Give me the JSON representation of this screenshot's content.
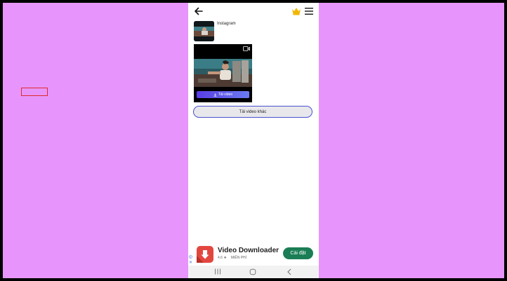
{
  "result": {
    "source_title": "Instagram"
  },
  "video": {
    "download_label": "Tải video"
  },
  "actions": {
    "more_label": "Tải video khác"
  },
  "ad": {
    "title": "Video Downloader",
    "rating": "4.6 ★",
    "price": "MIỄN PHÍ",
    "install_label": "Cài đặt",
    "close_label": "✕"
  },
  "colors": {
    "background": "#e795fc",
    "accent": "#5a3de6",
    "install": "#1a7d55",
    "highlight": "#e0282e"
  }
}
